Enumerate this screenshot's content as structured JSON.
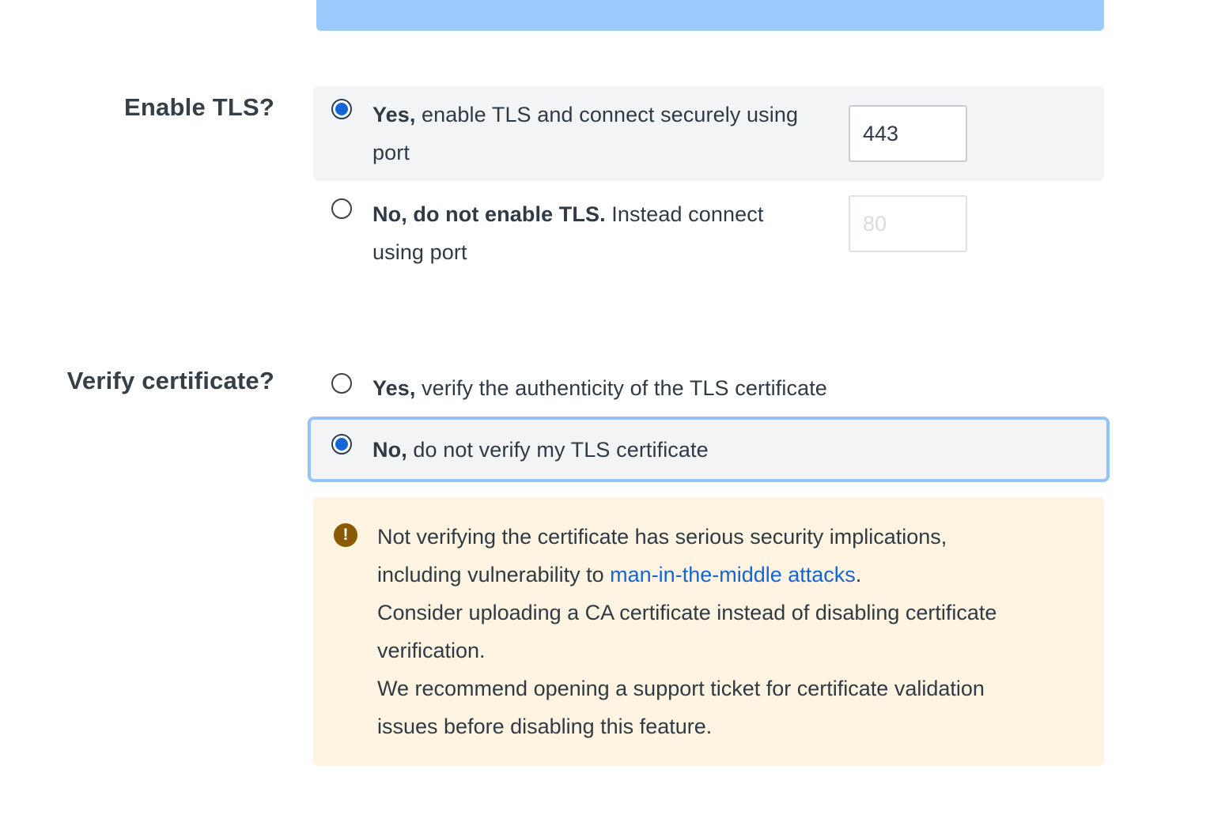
{
  "tls": {
    "label": "Enable TLS?",
    "yes": {
      "bold": "Yes,",
      "text_line1": " enable TLS and connect securely using",
      "text_line2": "port",
      "port_value": "443",
      "selected": true
    },
    "no": {
      "bold": "No, do not enable TLS.",
      "text_line1": " Instead connect",
      "text_line2": "using port",
      "port_placeholder": "80",
      "selected": false
    }
  },
  "verify": {
    "label": "Verify certificate?",
    "yes": {
      "bold": "Yes,",
      "text": " verify the authenticity of the TLS certificate",
      "selected": false
    },
    "no": {
      "bold": "No,",
      "text": " do not verify my TLS certificate",
      "selected": true
    }
  },
  "warning": {
    "icon": "exclamation-circle-icon",
    "line1": "Not verifying the certificate has serious security implications,",
    "line2_prefix": "including vulnerability to ",
    "link": "man-in-the-middle attacks",
    "line2_suffix": ".",
    "line3": "Consider uploading a CA certificate instead of disabling certificate",
    "line4": "verification.",
    "line5": "We recommend opening a support ticket for certificate validation",
    "line6": "issues before disabling this feature."
  },
  "colors": {
    "accent": "#1466d6",
    "banner": "#9bcbfd",
    "selected_bg": "#f2f4f6",
    "focus_ring": "#93c4f7",
    "warning_bg": "#fef4e1",
    "warning_icon": "#8a5a00"
  }
}
